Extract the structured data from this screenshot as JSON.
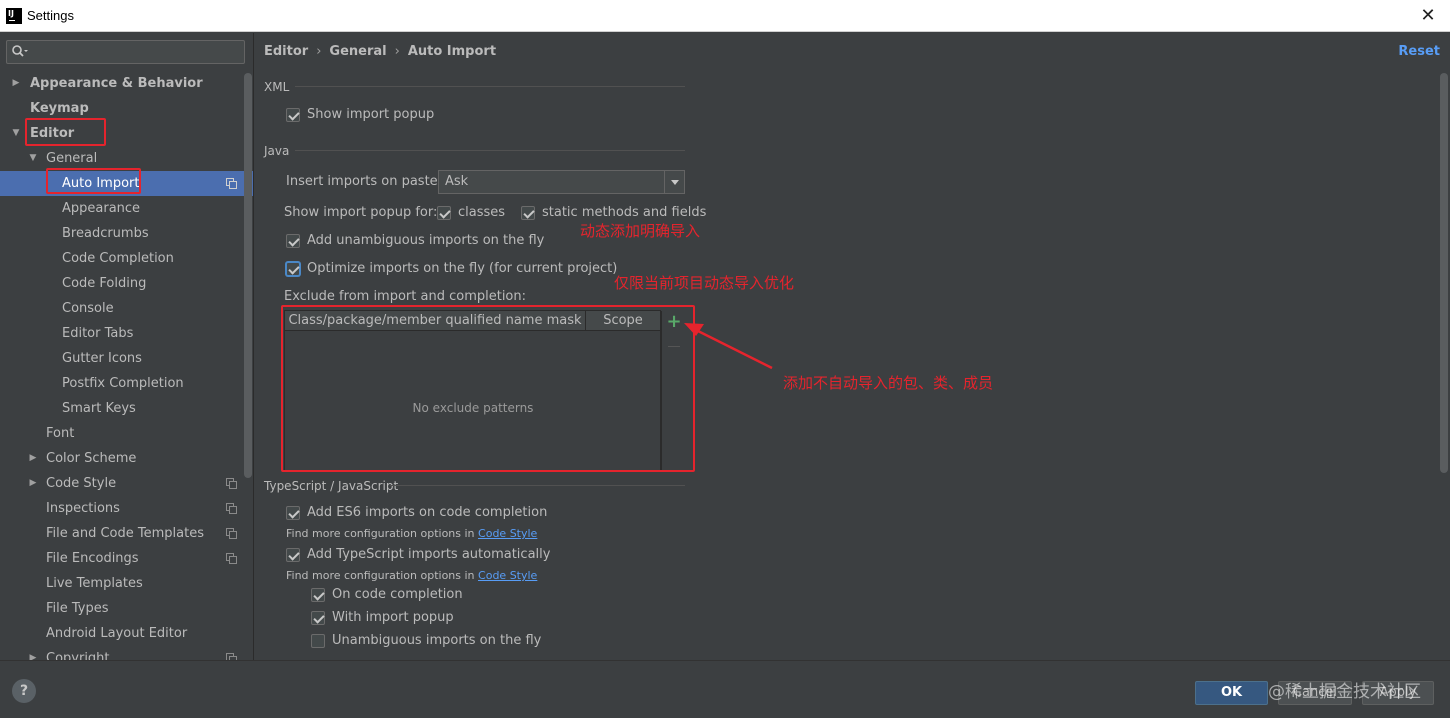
{
  "window": {
    "title": "Settings",
    "close": "✕",
    "app_icon_text": "IJ"
  },
  "search": {
    "placeholder": ""
  },
  "tree": [
    {
      "label": "Appearance & Behavior",
      "expanded": false,
      "bold": true
    },
    {
      "label": "Keymap",
      "bold": true
    },
    {
      "label": "Editor",
      "expanded": true,
      "bold": true
    },
    {
      "label": "General",
      "expanded": true
    },
    {
      "label": "Auto Import",
      "selected": true
    },
    {
      "label": "Appearance"
    },
    {
      "label": "Breadcrumbs"
    },
    {
      "label": "Code Completion"
    },
    {
      "label": "Code Folding"
    },
    {
      "label": "Console"
    },
    {
      "label": "Editor Tabs"
    },
    {
      "label": "Gutter Icons"
    },
    {
      "label": "Postfix Completion"
    },
    {
      "label": "Smart Keys"
    },
    {
      "label": "Font"
    },
    {
      "label": "Color Scheme",
      "expanded": false
    },
    {
      "label": "Code Style",
      "expanded": false
    },
    {
      "label": "Inspections"
    },
    {
      "label": "File and Code Templates"
    },
    {
      "label": "File Encodings"
    },
    {
      "label": "Live Templates"
    },
    {
      "label": "File Types"
    },
    {
      "label": "Android Layout Editor"
    },
    {
      "label": "Copyright",
      "expanded": false
    }
  ],
  "breadcrumb": {
    "items": [
      "Editor",
      "General",
      "Auto Import"
    ],
    "separator": "›"
  },
  "reset_label": "Reset",
  "xml": {
    "title": "XML",
    "show_import_popup": {
      "label": "Show import popup",
      "checked": true
    }
  },
  "java": {
    "title": "Java",
    "insert_imports_label": "Insert imports on paste:",
    "insert_imports_value": "Ask",
    "show_popup_for_label": "Show import popup for:",
    "classes": {
      "label": "classes",
      "checked": true
    },
    "static_methods": {
      "label": "static methods and fields",
      "checked": true
    },
    "add_unambiguous": {
      "label": "Add unambiguous imports on the fly",
      "checked": true
    },
    "optimize_imports": {
      "label": "Optimize imports on the fly (for current project)",
      "checked": true
    },
    "exclude_label": "Exclude from import and completion:",
    "table": {
      "columns": [
        "Class/package/member qualified name mask",
        "Scope"
      ],
      "empty_text": "No exclude patterns",
      "add": "+"
    }
  },
  "typescript": {
    "title": "TypeScript / JavaScript",
    "add_es6": {
      "label": "Add ES6 imports on code completion",
      "checked": true
    },
    "find_more_1": {
      "prefix": "Find more configuration options in ",
      "link": "Code Style"
    },
    "add_ts": {
      "label": "Add TypeScript imports automatically",
      "checked": true
    },
    "find_more_2": {
      "prefix": "Find more configuration options in ",
      "link": "Code Style"
    },
    "on_code_completion": {
      "label": "On code completion",
      "checked": true
    },
    "with_import_popup": {
      "label": "With import popup",
      "checked": true
    },
    "unambiguous_fly": {
      "label": "Unambiguous imports on the fly",
      "checked": false
    }
  },
  "annotations": {
    "dynamic_add": "动态添加明确导入",
    "optimize_note": "仅限当前项目动态导入优化",
    "exclude_note": "添加不自动导入的包、类、成员"
  },
  "buttons": {
    "ok": "OK",
    "cancel": "Cancel",
    "apply": "Apply",
    "help": "?"
  },
  "watermark": "@稀土掘金技术社区",
  "colors": {
    "accent": "#4b6eaf",
    "link": "#589df6",
    "annotation": "#e5242d",
    "add_green": "#59a869"
  }
}
